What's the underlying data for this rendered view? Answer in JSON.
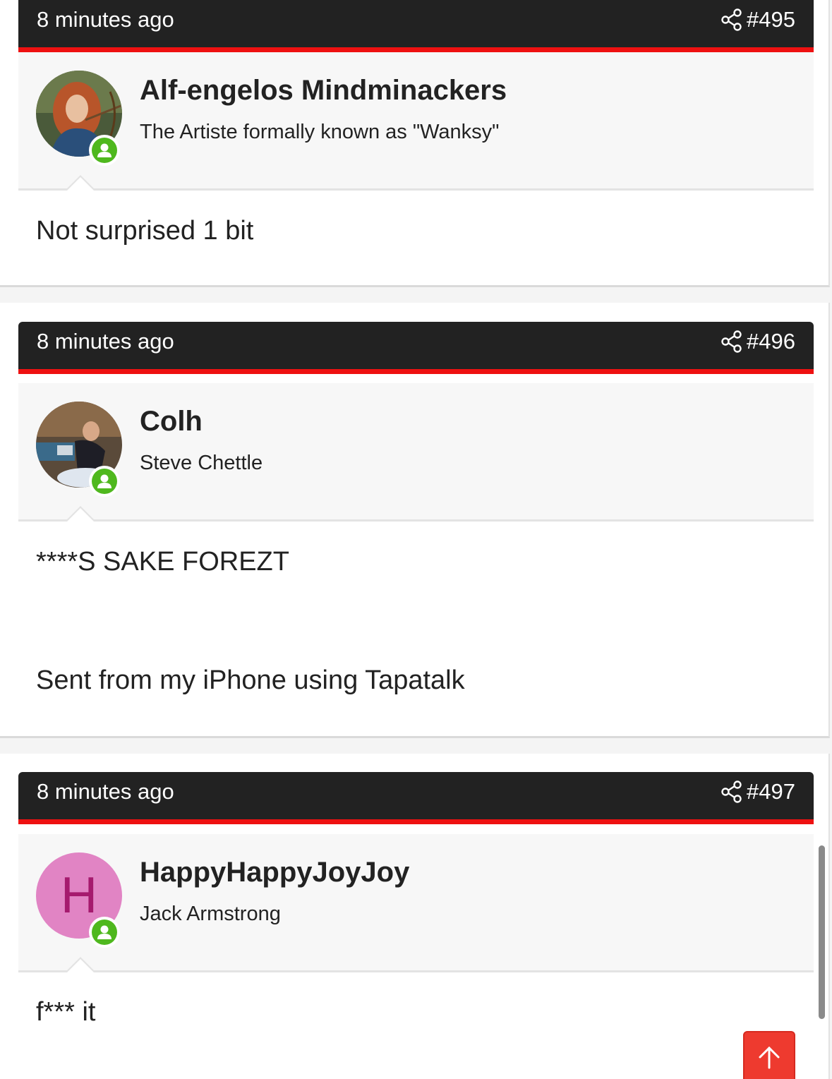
{
  "posts": [
    {
      "time": "8 minutes ago",
      "number": "#495",
      "username": "Alf-engelos Mindminackers",
      "user_title": "The Artiste formally known as \"Wanksy\"",
      "avatar": "photo-archer",
      "content": [
        "Not surprised 1 bit"
      ]
    },
    {
      "time": "8 minutes ago",
      "number": "#496",
      "username": "Colh",
      "user_title": "Steve Chettle",
      "avatar": "photo-footballer",
      "content": [
        "****S SAKE FOREZT",
        "Sent from my iPhone using Tapatalk"
      ]
    },
    {
      "time": "8 minutes ago",
      "number": "#497",
      "username": "HappyHappyJoyJoy",
      "user_title": "Jack Armstrong",
      "avatar_letter": "H",
      "content": [
        "f*** it"
      ]
    }
  ],
  "icons": {
    "share": "share-icon",
    "online": "user-online-icon",
    "scroll_top": "arrow-up-icon"
  },
  "colors": {
    "bar": "#222222",
    "accent": "#ee1111",
    "online": "#4fb81e",
    "scroll_top": "#ee3a2f",
    "letter_avatar_bg": "#e184c4",
    "letter_avatar_fg": "#a51a6e"
  }
}
